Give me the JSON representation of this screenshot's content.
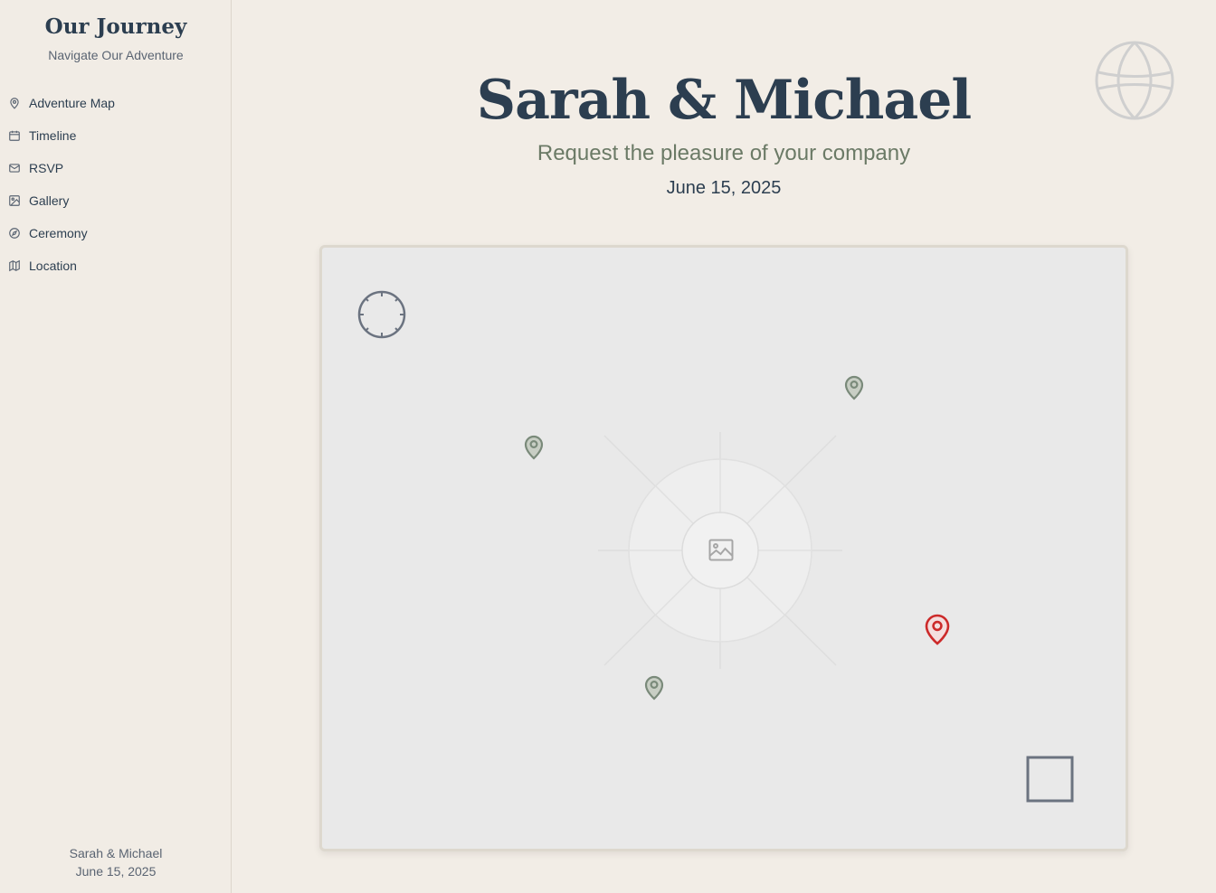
{
  "sidebar": {
    "title": "Our Journey",
    "subtitle": "Navigate Our Adventure",
    "items": [
      {
        "label": "Adventure Map",
        "icon": "map-pin-icon"
      },
      {
        "label": "Timeline",
        "icon": "calendar-icon"
      },
      {
        "label": "RSVP",
        "icon": "mail-icon"
      },
      {
        "label": "Gallery",
        "icon": "image-icon"
      },
      {
        "label": "Ceremony",
        "icon": "compass-icon"
      },
      {
        "label": "Location",
        "icon": "map-icon"
      }
    ],
    "footer_names": "Sarah & Michael",
    "footer_date": "June 15, 2025"
  },
  "header": {
    "names": "Sarah & Michael",
    "invitation": "Request the pleasure of your company",
    "date": "June 15, 2025"
  },
  "map": {
    "center_icon": "image-icon",
    "compass_icon": "compass-dial-icon",
    "corner_icon": "square-frame-icon",
    "pins": [
      {
        "name": "map-marker",
        "color": "#7a8a7a"
      },
      {
        "name": "map-marker",
        "color": "#7a8a7a"
      },
      {
        "name": "map-marker",
        "color": "#7a8a7a"
      },
      {
        "name": "map-marker-active",
        "color": "#cc2a2a"
      }
    ]
  },
  "colors": {
    "accent": "#2c3e50",
    "sage": "#6b7a66",
    "active_pin": "#cc2a2a",
    "background": "#f2ede6"
  }
}
